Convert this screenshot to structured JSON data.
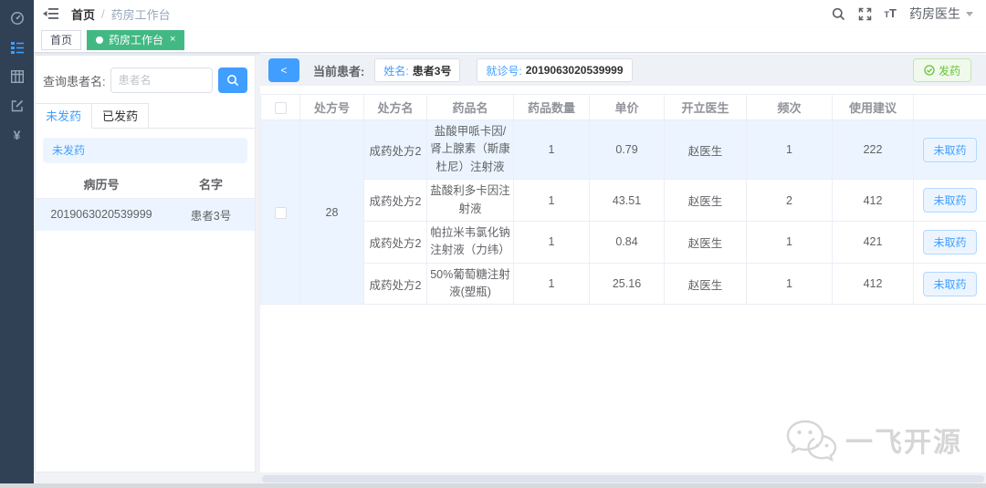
{
  "colors": {
    "accent_blue": "#409eff",
    "sidebar_bg": "#304156",
    "tab_active_green": "#42b983",
    "row_highlight": "#ecf5ff",
    "success_green": "#67c23a",
    "status_btn_border": "#b3d8ff"
  },
  "icons": {
    "sidebar": [
      "dashboard-icon",
      "worklist-icon",
      "table-icon",
      "edit-icon",
      "money-icon"
    ],
    "header": [
      "hamburger-icon",
      "search-icon",
      "fullscreen-icon",
      "font-size-icon",
      "caret-down-icon"
    ],
    "search_button": "search-icon",
    "dispense_button": "check-circle-icon",
    "watermark": "chat-bubbles-icon"
  },
  "header": {
    "breadcrumb": {
      "home": "首页",
      "separator": "/",
      "current": "药房工作台"
    },
    "user_name": "药房医生"
  },
  "tab_bar": {
    "tabs": [
      {
        "label": "首页",
        "active": false
      },
      {
        "label": "药房工作台",
        "active": true,
        "closable": true
      }
    ]
  },
  "left_panel": {
    "search_label": "查询患者名:",
    "search_placeholder": "患者名",
    "tabs": [
      {
        "label": "未发药",
        "active": true
      },
      {
        "label": "已发药",
        "active": false
      }
    ],
    "alert_text": "未发药",
    "patient_table": {
      "headers": [
        "病历号",
        "名字"
      ],
      "rows": [
        {
          "record_no": "2019063020539999",
          "name": "患者3号"
        }
      ]
    }
  },
  "main": {
    "back_button": "<",
    "current_patient_label": "当前患者:",
    "name_label": "姓名:",
    "name_value": "患者3号",
    "visit_label": "就诊号:",
    "visit_value": "2019063020539999",
    "dispense_button": "发药",
    "rx_table": {
      "headers": [
        "处方号",
        "处方名",
        "药品名",
        "药品数量",
        "单价",
        "开立医生",
        "频次",
        "使用建议"
      ],
      "prescription_no": "28",
      "rows": [
        {
          "rx_name": "成药处方2",
          "drug_name": "盐酸甲哌卡因/肾上腺素（斯康杜尼）注射液",
          "qty": "1",
          "unit_price": "0.79",
          "doctor": "赵医生",
          "frequency": "1",
          "usage_advice": "222",
          "status_button": "未取药"
        },
        {
          "rx_name": "成药处方2",
          "drug_name": "盐酸利多卡因注射液",
          "qty": "1",
          "unit_price": "43.51",
          "doctor": "赵医生",
          "frequency": "2",
          "usage_advice": "412",
          "status_button": "未取药"
        },
        {
          "rx_name": "成药处方2",
          "drug_name": "帕拉米韦氯化钠注射液（力纬）",
          "qty": "1",
          "unit_price": "0.84",
          "doctor": "赵医生",
          "frequency": "1",
          "usage_advice": "421",
          "status_button": "未取药"
        },
        {
          "rx_name": "成药处方2",
          "drug_name": "50%葡萄糖注射液(塑瓶)",
          "qty": "1",
          "unit_price": "25.16",
          "doctor": "赵医生",
          "frequency": "1",
          "usage_advice": "412",
          "status_button": "未取药"
        }
      ]
    }
  },
  "watermark": {
    "text": "一飞开源"
  }
}
